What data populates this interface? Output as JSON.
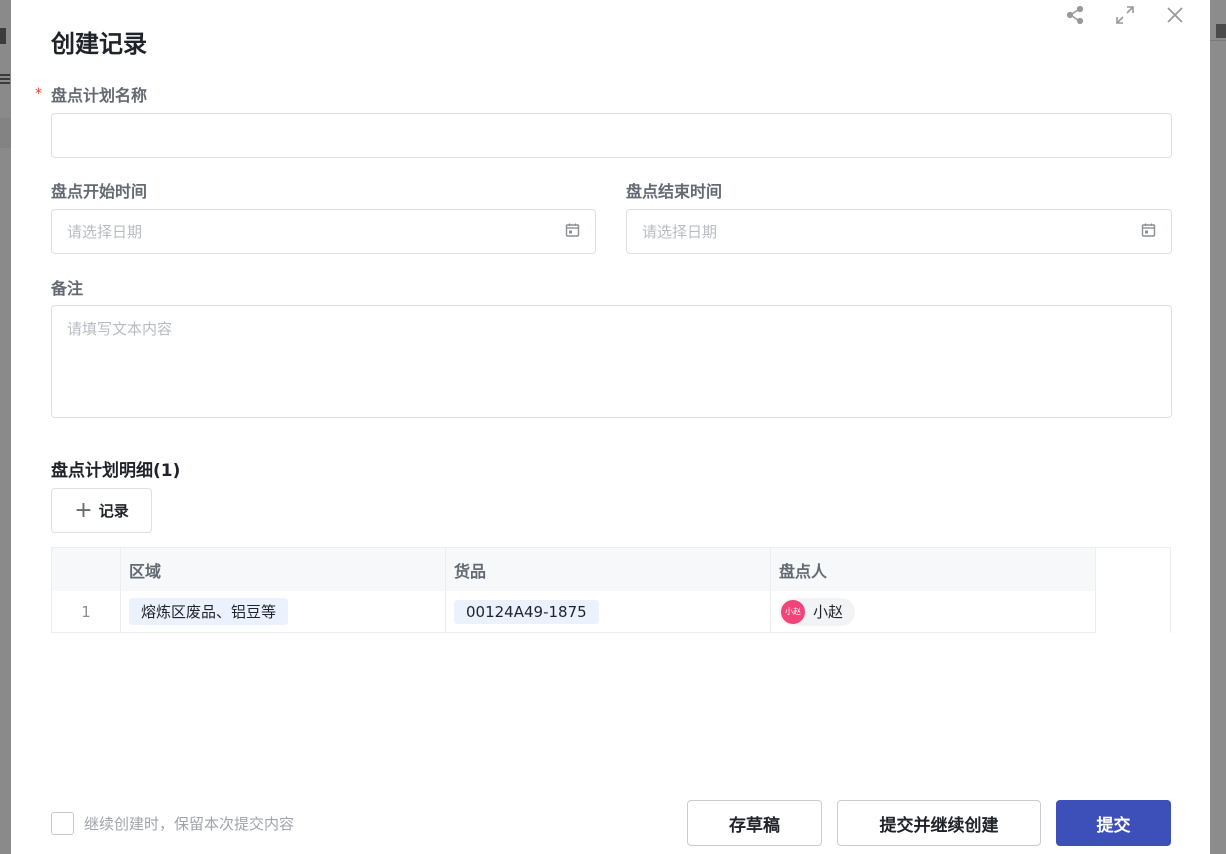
{
  "modal": {
    "title": "创建记录"
  },
  "form": {
    "plan_name": {
      "label": "盘点计划名称",
      "required_mark": "*",
      "value": ""
    },
    "start_time": {
      "label": "盘点开始时间",
      "placeholder": "请选择日期"
    },
    "end_time": {
      "label": "盘点结束时间",
      "placeholder": "请选择日期"
    },
    "remarks": {
      "label": "备注",
      "placeholder": "请填写文本内容"
    }
  },
  "details": {
    "title": "盘点计划明细(1)",
    "add_label": "记录",
    "columns": [
      "区域",
      "货品",
      "盘点人"
    ],
    "rows": [
      {
        "index": "1",
        "area": "熔炼区废品、铝豆等",
        "goods": "00124A49-1875",
        "avatar_text": "小赵",
        "checker": "小赵"
      }
    ]
  },
  "footer": {
    "keep_content_label": "继续创建时，保留本次提交内容",
    "draft_label": "存草稿",
    "submit_continue_label": "提交并继续创建",
    "submit_label": "提交"
  },
  "icons": {
    "share": "share-icon",
    "fullscreen": "fullscreen-icon",
    "close": "close-icon",
    "calendar": "calendar-icon",
    "plus": "plus-icon"
  },
  "colors": {
    "primary": "#3d4fb8",
    "required": "#e8412c",
    "avatar": "#f0447a",
    "tag_bg": "#ecf2fd"
  }
}
